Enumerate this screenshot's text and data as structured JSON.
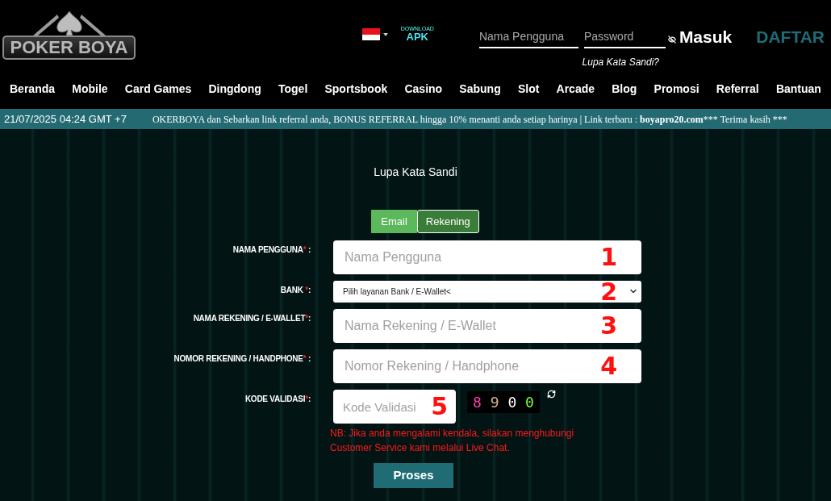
{
  "header": {
    "logo": "POKER BOYA",
    "apk": {
      "small": "DOWNLOAD",
      "big": "APK"
    },
    "login": {
      "username_placeholder": "Nama Pengguna",
      "password_placeholder": "Password",
      "login_button": "Masuk",
      "register_button": "DAFTAR",
      "forgot_link": "Lupa Kata Sandi?"
    }
  },
  "nav": [
    "Beranda",
    "Mobile",
    "Card Games",
    "Dingdong",
    "Togel",
    "Sportsbook",
    "Casino",
    "Sabung",
    "Slot",
    "Arcade",
    "Blog",
    "Promosi",
    "Referral",
    "Bantuan"
  ],
  "ticker": {
    "datetime": "21/07/2025 04:24 GMT +7",
    "segments": [
      {
        "text": "OKERBOYA dan Sebarkan link referral anda, BONUS REFERRAL hingga 10% menanti anda setiap harinya | Link terbaru : ",
        "bold": false
      },
      {
        "text": "boyapro20.com",
        "bold": true
      },
      {
        "text": "*** Terima kasih ***",
        "bold": false
      }
    ]
  },
  "page_title": "Lupa Kata Sandi",
  "tabs": [
    {
      "label": "Email",
      "selected": false
    },
    {
      "label": "Rekening",
      "selected": true
    }
  ],
  "fields": [
    {
      "kind": "input",
      "label": "NAMA PENGGUNA",
      "required_mark": "*",
      "colon": " :",
      "placeholder": "Nama Pengguna",
      "marker": "1"
    },
    {
      "kind": "select",
      "label": "BANK ",
      "required_mark": "*",
      "colon": ":",
      "value": "Pilih layanan Bank / E-Wallet<",
      "marker": "2"
    },
    {
      "kind": "input",
      "label": "NAMA REKENING / E-WALLET",
      "required_mark": "*",
      "colon": ":",
      "placeholder": "Nama Rekening / E-Wallet",
      "marker": "3"
    },
    {
      "kind": "input",
      "label": "NOMOR REKENING / HANDPHONE",
      "required_mark": "*",
      "colon": " :",
      "placeholder": "Nomor Rekening / Handphone",
      "marker": "4"
    },
    {
      "kind": "captcha",
      "label": "KODE VALIDASI",
      "required_mark": "*",
      "colon": ":",
      "placeholder": "Kode Validasi",
      "marker": "5",
      "captcha": "8 9 0 0"
    }
  ],
  "note": "NB: Jika anda mengalami kendala, silakan menghubungi Customer Service kami melalui Live Chat.",
  "submit": "Proses"
}
